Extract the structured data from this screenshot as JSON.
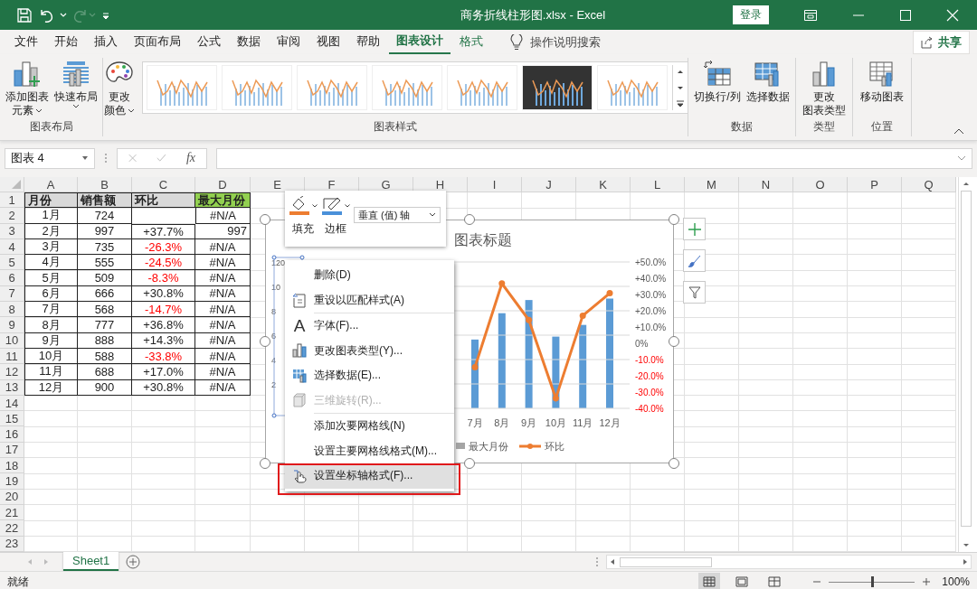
{
  "window": {
    "title": "商务折线柱形图.xlsx  -  Excel",
    "sign_in": "登录"
  },
  "quick_access": {
    "redo_disabled": true
  },
  "ribbon_tabs": [
    {
      "label": "文件",
      "selected": false,
      "kind": "normal"
    },
    {
      "label": "开始",
      "selected": false,
      "kind": "normal"
    },
    {
      "label": "插入",
      "selected": false,
      "kind": "normal"
    },
    {
      "label": "页面布局",
      "selected": false,
      "kind": "normal"
    },
    {
      "label": "公式",
      "selected": false,
      "kind": "normal"
    },
    {
      "label": "数据",
      "selected": false,
      "kind": "normal"
    },
    {
      "label": "审阅",
      "selected": false,
      "kind": "normal"
    },
    {
      "label": "视图",
      "selected": false,
      "kind": "normal"
    },
    {
      "label": "帮助",
      "selected": false,
      "kind": "normal"
    },
    {
      "label": "图表设计",
      "selected": true,
      "kind": "contextual"
    },
    {
      "label": "格式",
      "selected": false,
      "kind": "contextual"
    }
  ],
  "tell_me": {
    "placeholder": "操作说明搜索"
  },
  "share_button": "共享",
  "ribbon_groups": [
    {
      "name": "图表布局",
      "buttons": [
        {
          "lines": [
            "添加图表",
            "元素"
          ],
          "dropdown": true,
          "kind": "add-element"
        },
        {
          "lines": [
            "快速布局"
          ],
          "dropdown": true,
          "kind": "quick-layout"
        }
      ]
    },
    {
      "name": "图表样式",
      "buttons": [
        {
          "lines": [
            "更改",
            "颜色"
          ],
          "dropdown": true,
          "kind": "colors"
        }
      ],
      "styles": [
        {
          "kind": "light"
        },
        {
          "kind": "light"
        },
        {
          "kind": "light"
        },
        {
          "kind": "light"
        },
        {
          "kind": "light"
        },
        {
          "kind": "dark"
        },
        {
          "kind": "light"
        }
      ]
    },
    {
      "name": "数据",
      "buttons": [
        {
          "lines": [
            "切换行/列"
          ],
          "dropdown": false,
          "kind": "switch"
        },
        {
          "lines": [
            "选择数据"
          ],
          "dropdown": false,
          "kind": "select-data"
        }
      ]
    },
    {
      "name": "类型",
      "buttons": [
        {
          "lines": [
            "更改",
            "图表类型"
          ],
          "dropdown": false,
          "kind": "change-type"
        }
      ]
    },
    {
      "name": "位置",
      "buttons": [
        {
          "lines": [
            "移动图表"
          ],
          "dropdown": false,
          "kind": "move"
        }
      ]
    }
  ],
  "formula_bar": {
    "name_box": "图表 4",
    "function_label": "fx"
  },
  "sheet": {
    "columns": [
      "A",
      "B",
      "C",
      "D",
      "E",
      "F",
      "G",
      "H",
      "I",
      "J",
      "K",
      "L",
      "M",
      "N",
      "O",
      "P",
      "Q"
    ],
    "row_numbers": [
      "1",
      "2",
      "3",
      "4",
      "5",
      "6",
      "7",
      "8",
      "9",
      "10",
      "11",
      "12",
      "13",
      "14",
      "15",
      "16",
      "17",
      "18",
      "19",
      "20",
      "21",
      "22",
      "23"
    ],
    "header": [
      {
        "text": "月份",
        "color": "#d9d9d9"
      },
      {
        "text": "销售额",
        "color": "#d9d9d9"
      },
      {
        "text": "环比",
        "color": "#d9d9d9"
      },
      {
        "text": "最大月份",
        "color": "#92d050"
      }
    ],
    "rows": [
      {
        "month": "1月",
        "sales": "724",
        "max": {
          "text": "#N/A",
          "kind": "error"
        }
      },
      {
        "month": "2月",
        "sales": "997",
        "change": "+37.7%",
        "negative": false,
        "max": {
          "text": "997",
          "kind": "number"
        }
      },
      {
        "month": "3月",
        "sales": "735",
        "change": "-26.3%",
        "negative": true,
        "max": {
          "text": "#N/A",
          "kind": "error"
        }
      },
      {
        "month": "4月",
        "sales": "555",
        "change": "-24.5%",
        "negative": true,
        "max": {
          "text": "#N/A",
          "kind": "error"
        }
      },
      {
        "month": "5月",
        "sales": "509",
        "change": "-8.3%",
        "negative": true,
        "max": {
          "text": "#N/A",
          "kind": "error"
        }
      },
      {
        "month": "6月",
        "sales": "666",
        "change": "+30.8%",
        "negative": false,
        "max": {
          "text": "#N/A",
          "kind": "error"
        }
      },
      {
        "month": "7月",
        "sales": "568",
        "change": "-14.7%",
        "negative": true,
        "max": {
          "text": "#N/A",
          "kind": "error"
        }
      },
      {
        "month": "8月",
        "sales": "777",
        "change": "+36.8%",
        "negative": false,
        "max": {
          "text": "#N/A",
          "kind": "error"
        }
      },
      {
        "month": "9月",
        "sales": "888",
        "change": "+14.3%",
        "negative": false,
        "max": {
          "text": "#N/A",
          "kind": "error"
        }
      },
      {
        "month": "10月",
        "sales": "588",
        "change": "-33.8%",
        "negative": true,
        "max": {
          "text": "#N/A",
          "kind": "error"
        }
      },
      {
        "month": "11月",
        "sales": "688",
        "change": "+17.0%",
        "negative": false,
        "max": {
          "text": "#N/A",
          "kind": "error"
        }
      },
      {
        "month": "12月",
        "sales": "900",
        "change": "+30.8%",
        "negative": false,
        "max": {
          "text": "#N/A",
          "kind": "error"
        }
      }
    ]
  },
  "chart": {
    "selected": true,
    "title": "图表标题",
    "left_axis_labels": [
      "120",
      "10",
      "8",
      "6",
      "4",
      "2"
    ],
    "chart_data": {
      "type": "line",
      "categories": [
        "7月",
        "8月",
        "9月",
        "10月",
        "11月",
        "12月"
      ],
      "series": [
        {
          "name": "环比",
          "color": "#ed7d31",
          "marker": true,
          "values": [
            -14.7,
            36.8,
            14.3,
            -33.8,
            17.0,
            30.8
          ]
        }
      ],
      "ylim": [
        -40,
        50
      ],
      "yticks": [
        {
          "value": 50,
          "label": "+50.0%"
        },
        {
          "value": 40,
          "label": "+40.0%"
        },
        {
          "value": 30,
          "label": "+30.0%"
        },
        {
          "value": 20,
          "label": "+20.0%"
        },
        {
          "value": 10,
          "label": "+10.0%"
        },
        {
          "value": 0,
          "label": "0%"
        },
        {
          "value": -10,
          "label": "-10.0%"
        },
        {
          "value": -20,
          "label": "-20.0%"
        },
        {
          "value": -30,
          "label": "-30.0%"
        },
        {
          "value": -40,
          "label": "-40.0%"
        }
      ]
    },
    "legend_extra": [
      {
        "name": "最大月份",
        "color": "#a5a5a5"
      }
    ]
  },
  "mini_toolbar": {
    "buttons": [
      "填充",
      "边框"
    ],
    "element_select": "垂直 (值) 轴"
  },
  "context_menu": {
    "groups": [
      [
        {
          "label": "删除(D)",
          "kind": "none",
          "disabled": false,
          "selected": false,
          "outlined": false
        },
        {
          "label": "重设以匹配样式(A)",
          "kind": "reset",
          "disabled": false,
          "selected": false,
          "outlined": false
        }
      ],
      [
        {
          "label": "字体(F)...",
          "kind": "font",
          "glyph": "A",
          "disabled": false,
          "selected": false,
          "outlined": false
        },
        {
          "label": "更改图表类型(Y)...",
          "kind": "chart-type",
          "disabled": false,
          "selected": false,
          "outlined": false
        },
        {
          "label": "选择数据(E)...",
          "kind": "select-data",
          "disabled": false,
          "selected": false,
          "outlined": false
        },
        {
          "label": "三维旋转(R)...",
          "kind": "rotate",
          "disabled": true,
          "selected": false,
          "outlined": false
        }
      ],
      [
        {
          "label": "添加次要网格线(N)",
          "kind": "none",
          "disabled": false,
          "selected": false,
          "outlined": false
        },
        {
          "label": "设置主要网格线格式(M)...",
          "kind": "none",
          "disabled": false,
          "selected": false,
          "outlined": false
        },
        {
          "label": "设置坐标轴格式(F)...",
          "kind": "axis-format",
          "disabled": false,
          "selected": true,
          "outlined": true
        }
      ]
    ]
  },
  "sheet_tabs": [
    {
      "label": "Sheet1",
      "selected": true
    }
  ],
  "status_bar": {
    "text": "就绪",
    "views": [
      {
        "kind": "normal",
        "selected": true
      },
      {
        "kind": "page-layout",
        "selected": false
      },
      {
        "kind": "page-break",
        "selected": false
      }
    ],
    "zoom": {
      "level": 0.5,
      "reading": "100%"
    }
  }
}
